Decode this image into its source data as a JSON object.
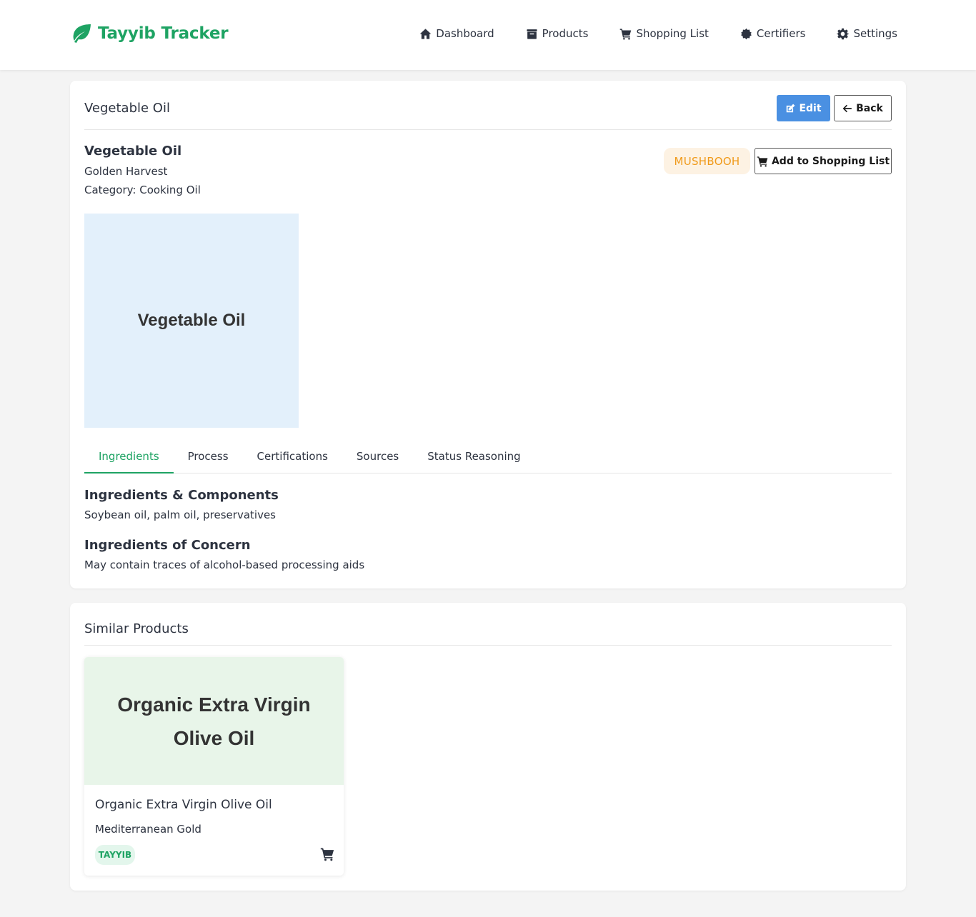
{
  "app": {
    "brand": "Tayyib Tracker",
    "brand_color": "#1ea363"
  },
  "nav": {
    "items": [
      {
        "label": "Dashboard",
        "icon": "home-icon"
      },
      {
        "label": "Products",
        "icon": "box-icon"
      },
      {
        "label": "Shopping List",
        "icon": "cart-icon"
      },
      {
        "label": "Certifiers",
        "icon": "certificate-icon"
      },
      {
        "label": "Settings",
        "icon": "gear-icon"
      }
    ]
  },
  "product": {
    "header_title": "Vegetable Oil",
    "edit_label": "Edit",
    "back_label": "Back",
    "name": "Vegetable Oil",
    "brand": "Golden Harvest",
    "category": "Category: Cooking Oil",
    "status": "MUSHBOOH",
    "status_color": "#f09a1a",
    "add_to_list_label": "Add to Shopping List",
    "image_text": "Vegetable Oil"
  },
  "tabs": [
    {
      "label": "Ingredients",
      "active": true
    },
    {
      "label": "Process",
      "active": false
    },
    {
      "label": "Certifications",
      "active": false
    },
    {
      "label": "Sources",
      "active": false
    },
    {
      "label": "Status Reasoning",
      "active": false
    }
  ],
  "ingredients": {
    "components_title": "Ingredients & Components",
    "components_text": "Soybean oil, palm oil, preservatives",
    "concern_title": "Ingredients of Concern",
    "concern_text": "May contain traces of alcohol-based processing aids"
  },
  "similar": {
    "title": "Similar Products",
    "items": [
      {
        "image_text": "Organic Extra Virgin Olive Oil",
        "name": "Organic Extra Virgin Olive Oil",
        "brand": "Mediterranean Gold",
        "status": "TAYYIB"
      }
    ]
  }
}
